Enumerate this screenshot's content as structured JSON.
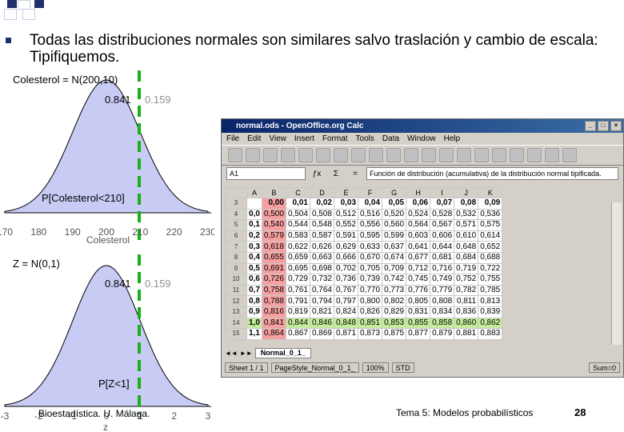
{
  "slide": {
    "bullet_text": "Todas las distribuciones normales son similares salvo traslación y cambio de escala: Tipifiquemos.",
    "footer_left": "Bioestadística. U. Málaga.",
    "footer_topic": "Tema 5: Modelos probabilísticos",
    "page_number": "28",
    "colors": {
      "accent": "#1f2f6b",
      "curve_fill": "#c8ccf4",
      "dash": "#19b019"
    }
  },
  "plot_top": {
    "title": "Colesterol = N(200,10)",
    "left_area": "0.841",
    "right_area": "0.159",
    "region_label": "P[Colesterol<210]",
    "xlabel": "Colesterol",
    "ticks": [
      "170",
      "180",
      "190",
      "200",
      "210",
      "220",
      "230"
    ]
  },
  "plot_bottom": {
    "title": "Z = N(0,1)",
    "left_area": "0.841",
    "right_area": "0.159",
    "region_label": "P[Z<1]",
    "xlabel": "z",
    "ticks": [
      "-3",
      "-2",
      "-1",
      "0",
      "1",
      "2",
      "3"
    ]
  },
  "calc": {
    "window_title": "normal.ods - OpenOffice.org Calc",
    "menus": [
      "File",
      "Edit",
      "View",
      "Insert",
      "Format",
      "Tools",
      "Data",
      "Window",
      "Help"
    ],
    "cell_ref": "A1",
    "formula": "Función de distribución (acumulativa) de la distribución normal tipificada.",
    "columns": [
      "",
      "A",
      "B",
      "C",
      "D",
      "E",
      "F",
      "G",
      "H",
      "I",
      "J",
      "K"
    ],
    "rows": [
      {
        "n": "3",
        "cells": [
          "",
          "0,00",
          "0,01",
          "0,02",
          "0,03",
          "0,04",
          "0,05",
          "0,06",
          "0,07",
          "0,08",
          "0,09"
        ]
      },
      {
        "n": "4",
        "cells": [
          "0,0",
          "0,500",
          "0,504",
          "0,508",
          "0,512",
          "0,516",
          "0,520",
          "0,524",
          "0,528",
          "0,532",
          "0,536"
        ]
      },
      {
        "n": "5",
        "cells": [
          "0,1",
          "0,540",
          "0,544",
          "0,548",
          "0,552",
          "0,556",
          "0,560",
          "0,564",
          "0,567",
          "0,571",
          "0,575"
        ]
      },
      {
        "n": "6",
        "cells": [
          "0,2",
          "0,579",
          "0,583",
          "0,587",
          "0,591",
          "0,595",
          "0,599",
          "0,603",
          "0,606",
          "0,610",
          "0,614"
        ]
      },
      {
        "n": "7",
        "cells": [
          "0,3",
          "0,618",
          "0,622",
          "0,626",
          "0,629",
          "0,633",
          "0,637",
          "0,641",
          "0,644",
          "0,648",
          "0,652"
        ]
      },
      {
        "n": "8",
        "cells": [
          "0,4",
          "0,655",
          "0,659",
          "0,663",
          "0,666",
          "0,670",
          "0,674",
          "0,677",
          "0,681",
          "0,684",
          "0,688"
        ]
      },
      {
        "n": "9",
        "cells": [
          "0,5",
          "0,691",
          "0,695",
          "0,698",
          "0,702",
          "0,705",
          "0,709",
          "0,712",
          "0,716",
          "0,719",
          "0,722"
        ]
      },
      {
        "n": "10",
        "cells": [
          "0,6",
          "0,726",
          "0,729",
          "0,732",
          "0,736",
          "0,739",
          "0,742",
          "0,745",
          "0,749",
          "0,752",
          "0,755"
        ]
      },
      {
        "n": "11",
        "cells": [
          "0,7",
          "0,758",
          "0,761",
          "0,764",
          "0,767",
          "0,770",
          "0,773",
          "0,776",
          "0,779",
          "0,782",
          "0,785"
        ]
      },
      {
        "n": "12",
        "cells": [
          "0,8",
          "0,788",
          "0,791",
          "0,794",
          "0,797",
          "0,800",
          "0,802",
          "0,805",
          "0,808",
          "0,811",
          "0,813"
        ]
      },
      {
        "n": "13",
        "cells": [
          "0,9",
          "0,816",
          "0,819",
          "0,821",
          "0,824",
          "0,826",
          "0,829",
          "0,831",
          "0,834",
          "0,836",
          "0,839"
        ]
      },
      {
        "n": "14",
        "cells": [
          "1,0",
          "0,841",
          "0,844",
          "0,846",
          "0,848",
          "0,851",
          "0,853",
          "0,855",
          "0,858",
          "0,860",
          "0,862"
        ]
      },
      {
        "n": "15",
        "cells": [
          "1,1",
          "0,864",
          "0,867",
          "0,869",
          "0,871",
          "0,873",
          "0,875",
          "0,877",
          "0,879",
          "0,881",
          "0,883"
        ]
      }
    ],
    "sheet_tab": "Normal_0_1_",
    "status": [
      "Sheet 1 / 1",
      "PageStyle_Normal_0_1_",
      "100%",
      "STD",
      "Sum=0"
    ]
  }
}
